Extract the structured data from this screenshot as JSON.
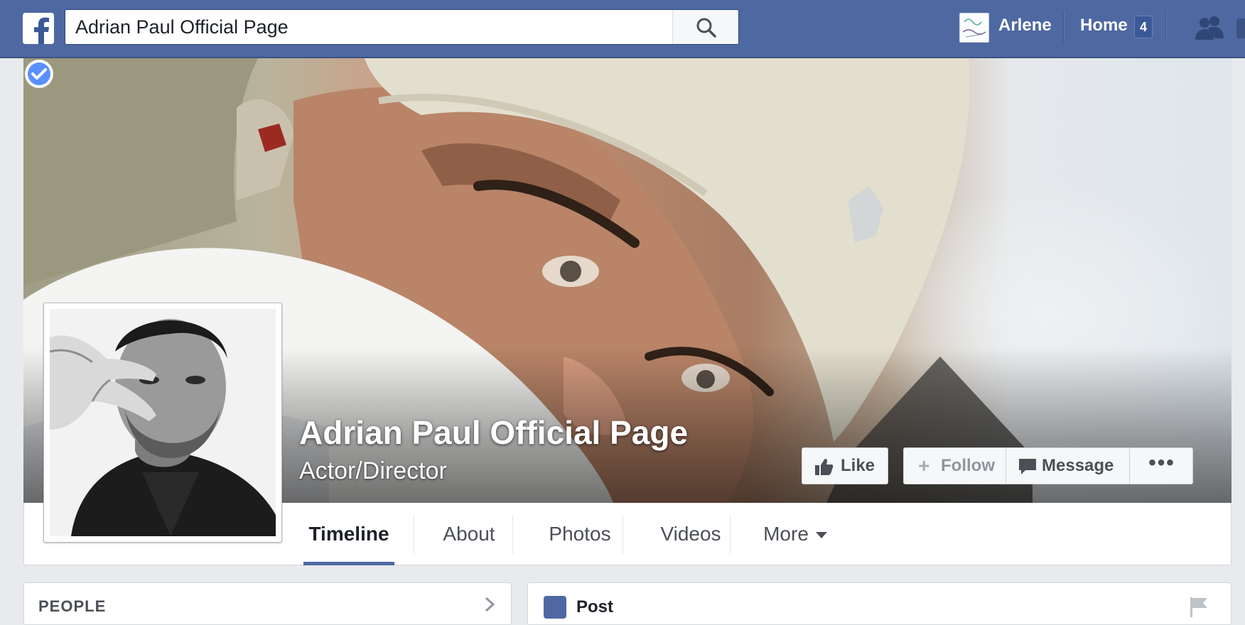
{
  "topbar": {
    "logo_icon": "facebook-logo-icon",
    "search_value": "Adrian Paul Official Page",
    "search_icon": "search-icon",
    "user_name": "Arlene",
    "home_label": "Home",
    "home_count": "4",
    "friends_icon": "friend-requests-icon"
  },
  "page": {
    "name": "Adrian Paul Official Page",
    "category": "Actor/Director",
    "verified_icon": "verified-badge-icon"
  },
  "actions": {
    "like_label": "Like",
    "follow_label": "Follow",
    "message_label": "Message",
    "more_label": "•••"
  },
  "tabs": [
    {
      "label": "Timeline",
      "active": true
    },
    {
      "label": "About",
      "active": false
    },
    {
      "label": "Photos",
      "active": false
    },
    {
      "label": "Videos",
      "active": false
    },
    {
      "label": "More",
      "active": false
    }
  ],
  "panels": {
    "people_title": "PEOPLE",
    "post_title": "Post"
  },
  "colors": {
    "brand_blue": "#4e69a2",
    "verified_blue": "#5890ff",
    "background": "#e9eaed"
  }
}
